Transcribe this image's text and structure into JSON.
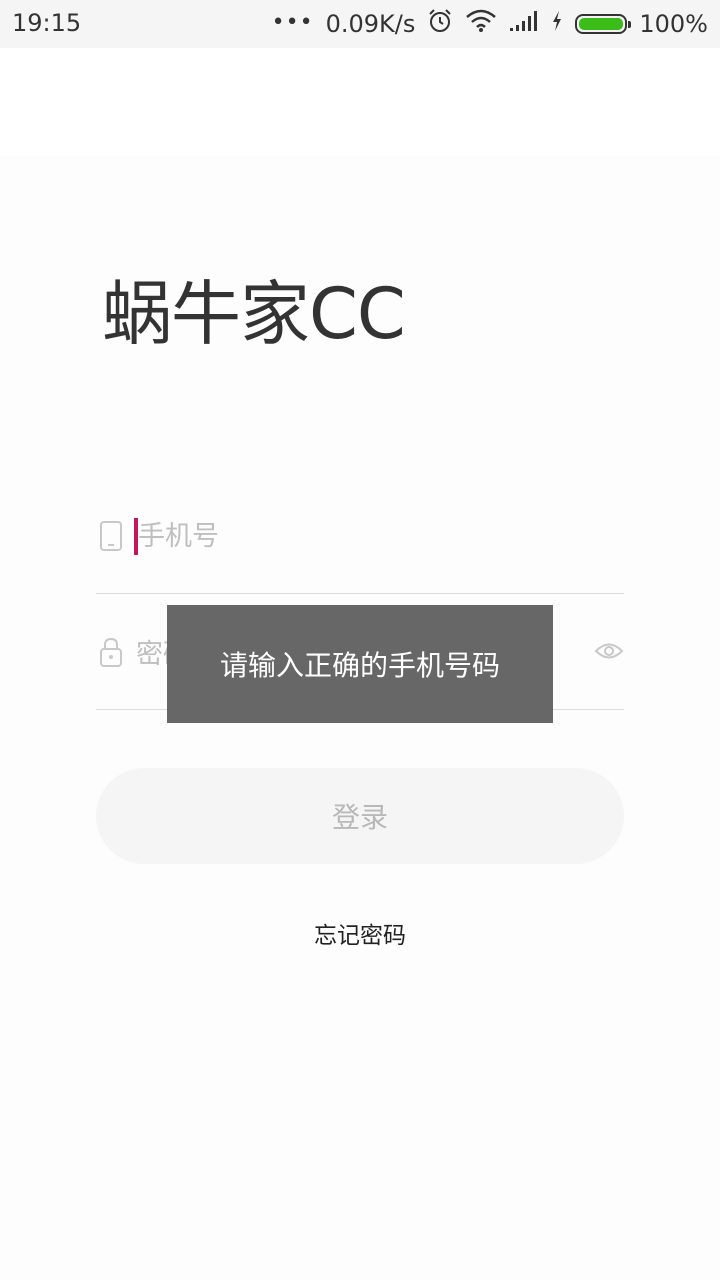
{
  "status_bar": {
    "time": "19:15",
    "network_speed": "0.09K/s",
    "battery_percent": "100%",
    "battery_level": 1.0,
    "icons": [
      "more-dots-icon",
      "alarm-icon",
      "wifi-icon",
      "signal-icon",
      "charging-icon",
      "battery-icon"
    ]
  },
  "app": {
    "title": "蜗牛家CC"
  },
  "form": {
    "phone_placeholder": "手机号",
    "password_placeholder": "密码",
    "login_label": "登录",
    "forgot_label": "忘记密码"
  },
  "toast": {
    "message": "请输入正确的手机号码"
  },
  "colors": {
    "cursor": "#c51662",
    "toast_bg": "#676767",
    "battery": "#3cbc19",
    "button_bg": "#f5f5f5"
  }
}
